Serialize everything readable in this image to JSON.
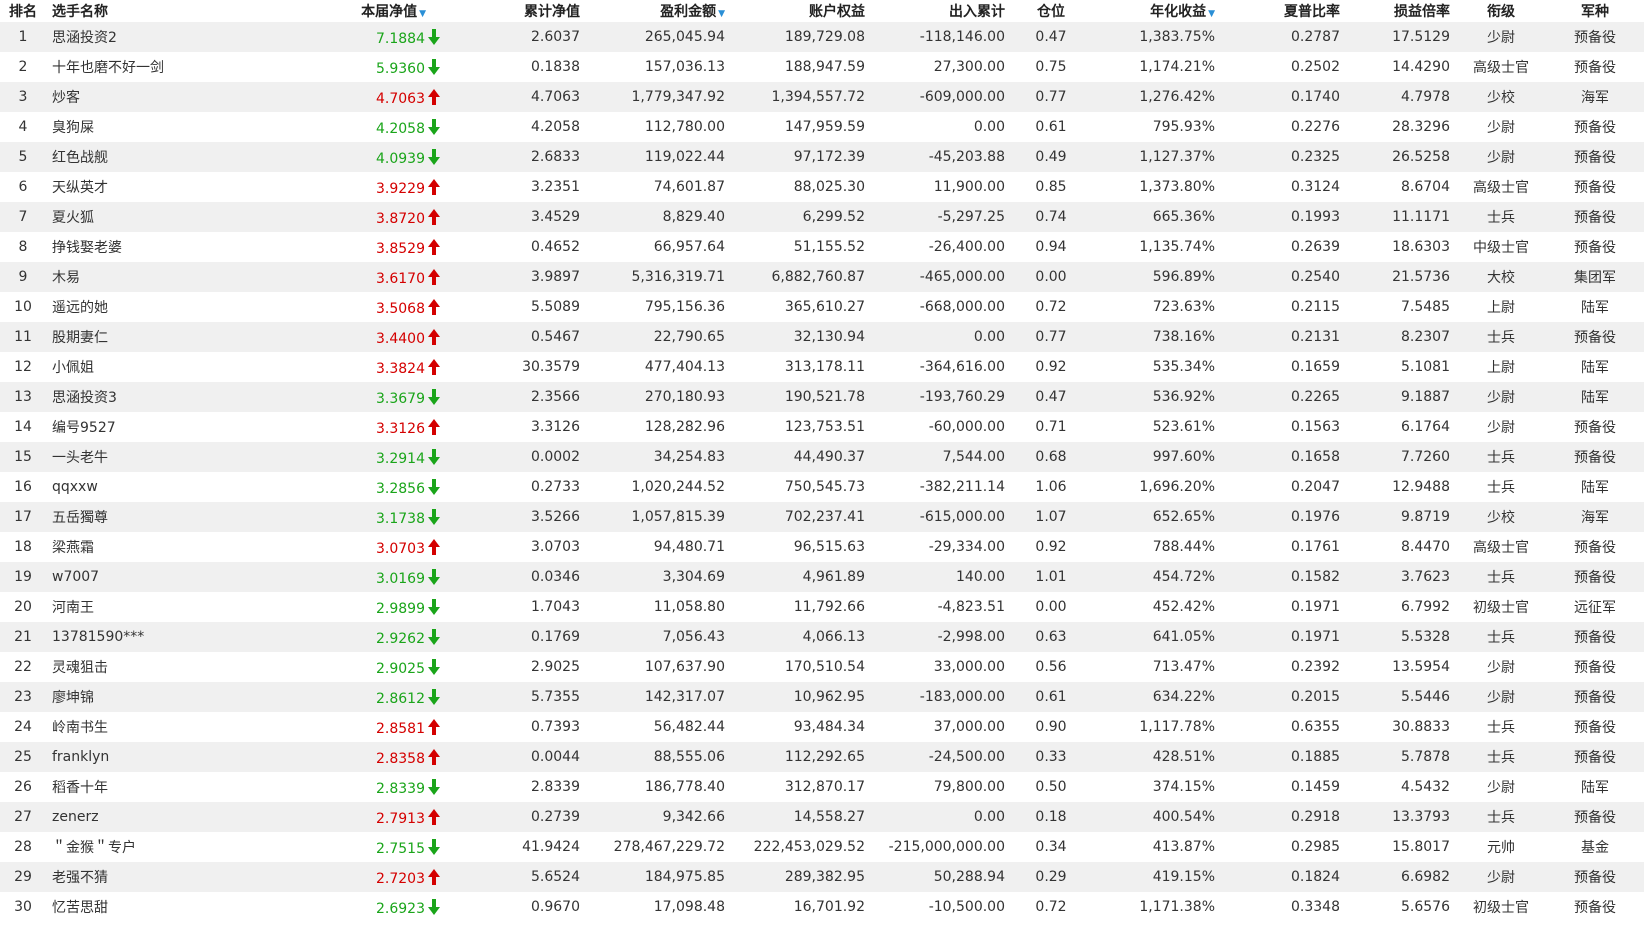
{
  "colors": {
    "up": "#d40000",
    "down": "#1aa51a",
    "sort_indicator": "#2a8fd6",
    "row_stripe": "#f0f0f0"
  },
  "headers": {
    "rank": "排名",
    "name": "选手名称",
    "nav": "本届净值",
    "cum_nav": "累计净值",
    "profit": "盈利金额",
    "equity": "账户权益",
    "flow": "出入累计",
    "position": "仓位",
    "annual": "年化收益",
    "sharpe": "夏普比率",
    "pl_ratio": "损益倍率",
    "title": "衔级",
    "corps": "军种"
  },
  "sort_icon": "sort-desc-icon",
  "rows": [
    {
      "rank": "1",
      "name": "思涵投资2",
      "nav": "7.1884",
      "trend": "down",
      "cum_nav": "2.6037",
      "profit": "265,045.94",
      "equity": "189,729.08",
      "flow": "-118,146.00",
      "position": "0.47",
      "annual": "1,383.75%",
      "sharpe": "0.2787",
      "pl_ratio": "17.5129",
      "title": "少尉",
      "corps": "预备役"
    },
    {
      "rank": "2",
      "name": "十年也磨不好一剑",
      "nav": "5.9360",
      "trend": "down",
      "cum_nav": "0.1838",
      "profit": "157,036.13",
      "equity": "188,947.59",
      "flow": "27,300.00",
      "position": "0.75",
      "annual": "1,174.21%",
      "sharpe": "0.2502",
      "pl_ratio": "14.4290",
      "title": "高级士官",
      "corps": "预备役"
    },
    {
      "rank": "3",
      "name": "炒客",
      "nav": "4.7063",
      "trend": "up",
      "cum_nav": "4.7063",
      "profit": "1,779,347.92",
      "equity": "1,394,557.72",
      "flow": "-609,000.00",
      "position": "0.77",
      "annual": "1,276.42%",
      "sharpe": "0.1740",
      "pl_ratio": "4.7978",
      "title": "少校",
      "corps": "海军"
    },
    {
      "rank": "4",
      "name": "臭狗屎",
      "nav": "4.2058",
      "trend": "down",
      "cum_nav": "4.2058",
      "profit": "112,780.00",
      "equity": "147,959.59",
      "flow": "0.00",
      "position": "0.61",
      "annual": "795.93%",
      "sharpe": "0.2276",
      "pl_ratio": "28.3296",
      "title": "少尉",
      "corps": "预备役"
    },
    {
      "rank": "5",
      "name": "红色战舰",
      "nav": "4.0939",
      "trend": "down",
      "cum_nav": "2.6833",
      "profit": "119,022.44",
      "equity": "97,172.39",
      "flow": "-45,203.88",
      "position": "0.49",
      "annual": "1,127.37%",
      "sharpe": "0.2325",
      "pl_ratio": "26.5258",
      "title": "少尉",
      "corps": "预备役"
    },
    {
      "rank": "6",
      "name": "天纵英才",
      "nav": "3.9229",
      "trend": "up",
      "cum_nav": "3.2351",
      "profit": "74,601.87",
      "equity": "88,025.30",
      "flow": "11,900.00",
      "position": "0.85",
      "annual": "1,373.80%",
      "sharpe": "0.3124",
      "pl_ratio": "8.6704",
      "title": "高级士官",
      "corps": "预备役"
    },
    {
      "rank": "7",
      "name": "夏火狐",
      "nav": "3.8720",
      "trend": "up",
      "cum_nav": "3.4529",
      "profit": "8,829.40",
      "equity": "6,299.52",
      "flow": "-5,297.25",
      "position": "0.74",
      "annual": "665.36%",
      "sharpe": "0.1993",
      "pl_ratio": "11.1171",
      "title": "士兵",
      "corps": "预备役"
    },
    {
      "rank": "8",
      "name": "挣钱娶老婆",
      "nav": "3.8529",
      "trend": "up",
      "cum_nav": "0.4652",
      "profit": "66,957.64",
      "equity": "51,155.52",
      "flow": "-26,400.00",
      "position": "0.94",
      "annual": "1,135.74%",
      "sharpe": "0.2639",
      "pl_ratio": "18.6303",
      "title": "中级士官",
      "corps": "预备役"
    },
    {
      "rank": "9",
      "name": "木易",
      "nav": "3.6170",
      "trend": "up",
      "cum_nav": "3.9897",
      "profit": "5,316,319.71",
      "equity": "6,882,760.87",
      "flow": "-465,000.00",
      "position": "0.00",
      "annual": "596.89%",
      "sharpe": "0.2540",
      "pl_ratio": "21.5736",
      "title": "大校",
      "corps": "集团军"
    },
    {
      "rank": "10",
      "name": "遥远的她",
      "nav": "3.5068",
      "trend": "up",
      "cum_nav": "5.5089",
      "profit": "795,156.36",
      "equity": "365,610.27",
      "flow": "-668,000.00",
      "position": "0.72",
      "annual": "723.63%",
      "sharpe": "0.2115",
      "pl_ratio": "7.5485",
      "title": "上尉",
      "corps": "陆军"
    },
    {
      "rank": "11",
      "name": "股期妻仁",
      "nav": "3.4400",
      "trend": "up",
      "cum_nav": "0.5467",
      "profit": "22,790.65",
      "equity": "32,130.94",
      "flow": "0.00",
      "position": "0.77",
      "annual": "738.16%",
      "sharpe": "0.2131",
      "pl_ratio": "8.2307",
      "title": "士兵",
      "corps": "预备役"
    },
    {
      "rank": "12",
      "name": "小佩姐",
      "nav": "3.3824",
      "trend": "up",
      "cum_nav": "30.3579",
      "profit": "477,404.13",
      "equity": "313,178.11",
      "flow": "-364,616.00",
      "position": "0.92",
      "annual": "535.34%",
      "sharpe": "0.1659",
      "pl_ratio": "5.1081",
      "title": "上尉",
      "corps": "陆军"
    },
    {
      "rank": "13",
      "name": "思涵投资3",
      "nav": "3.3679",
      "trend": "down",
      "cum_nav": "2.3566",
      "profit": "270,180.93",
      "equity": "190,521.78",
      "flow": "-193,760.29",
      "position": "0.47",
      "annual": "536.92%",
      "sharpe": "0.2265",
      "pl_ratio": "9.1887",
      "title": "少尉",
      "corps": "陆军"
    },
    {
      "rank": "14",
      "name": "编号9527",
      "nav": "3.3126",
      "trend": "up",
      "cum_nav": "3.3126",
      "profit": "128,282.96",
      "equity": "123,753.51",
      "flow": "-60,000.00",
      "position": "0.71",
      "annual": "523.61%",
      "sharpe": "0.1563",
      "pl_ratio": "6.1764",
      "title": "少尉",
      "corps": "预备役"
    },
    {
      "rank": "15",
      "name": "一头老牛",
      "nav": "3.2914",
      "trend": "down",
      "cum_nav": "0.0002",
      "profit": "34,254.83",
      "equity": "44,490.37",
      "flow": "7,544.00",
      "position": "0.68",
      "annual": "997.60%",
      "sharpe": "0.1658",
      "pl_ratio": "7.7260",
      "title": "士兵",
      "corps": "预备役"
    },
    {
      "rank": "16",
      "name": "qqxxw",
      "nav": "3.2856",
      "trend": "down",
      "cum_nav": "0.2733",
      "profit": "1,020,244.52",
      "equity": "750,545.73",
      "flow": "-382,211.14",
      "position": "1.06",
      "annual": "1,696.20%",
      "sharpe": "0.2047",
      "pl_ratio": "12.9488",
      "title": "士兵",
      "corps": "陆军"
    },
    {
      "rank": "17",
      "name": "五岳獨尊",
      "nav": "3.1738",
      "trend": "down",
      "cum_nav": "3.5266",
      "profit": "1,057,815.39",
      "equity": "702,237.41",
      "flow": "-615,000.00",
      "position": "1.07",
      "annual": "652.65%",
      "sharpe": "0.1976",
      "pl_ratio": "9.8719",
      "title": "少校",
      "corps": "海军"
    },
    {
      "rank": "18",
      "name": "梁燕霜",
      "nav": "3.0703",
      "trend": "up",
      "cum_nav": "3.0703",
      "profit": "94,480.71",
      "equity": "96,515.63",
      "flow": "-29,334.00",
      "position": "0.92",
      "annual": "788.44%",
      "sharpe": "0.1761",
      "pl_ratio": "8.4470",
      "title": "高级士官",
      "corps": "预备役"
    },
    {
      "rank": "19",
      "name": "w7007",
      "nav": "3.0169",
      "trend": "down",
      "cum_nav": "0.0346",
      "profit": "3,304.69",
      "equity": "4,961.89",
      "flow": "140.00",
      "position": "1.01",
      "annual": "454.72%",
      "sharpe": "0.1582",
      "pl_ratio": "3.7623",
      "title": "士兵",
      "corps": "预备役"
    },
    {
      "rank": "20",
      "name": "河南王",
      "nav": "2.9899",
      "trend": "down",
      "cum_nav": "1.7043",
      "profit": "11,058.80",
      "equity": "11,792.66",
      "flow": "-4,823.51",
      "position": "0.00",
      "annual": "452.42%",
      "sharpe": "0.1971",
      "pl_ratio": "6.7992",
      "title": "初级士官",
      "corps": "远征军"
    },
    {
      "rank": "21",
      "name": "13781590***",
      "nav": "2.9262",
      "trend": "down",
      "cum_nav": "0.1769",
      "profit": "7,056.43",
      "equity": "4,066.13",
      "flow": "-2,998.00",
      "position": "0.63",
      "annual": "641.05%",
      "sharpe": "0.1971",
      "pl_ratio": "5.5328",
      "title": "士兵",
      "corps": "预备役"
    },
    {
      "rank": "22",
      "name": "灵魂狙击",
      "nav": "2.9025",
      "trend": "down",
      "cum_nav": "2.9025",
      "profit": "107,637.90",
      "equity": "170,510.54",
      "flow": "33,000.00",
      "position": "0.56",
      "annual": "713.47%",
      "sharpe": "0.2392",
      "pl_ratio": "13.5954",
      "title": "少尉",
      "corps": "预备役"
    },
    {
      "rank": "23",
      "name": "廖坤锦",
      "nav": "2.8612",
      "trend": "down",
      "cum_nav": "5.7355",
      "profit": "142,317.07",
      "equity": "10,962.95",
      "flow": "-183,000.00",
      "position": "0.61",
      "annual": "634.22%",
      "sharpe": "0.2015",
      "pl_ratio": "5.5446",
      "title": "少尉",
      "corps": "预备役"
    },
    {
      "rank": "24",
      "name": "岭南书生",
      "nav": "2.8581",
      "trend": "up",
      "cum_nav": "0.7393",
      "profit": "56,482.44",
      "equity": "93,484.34",
      "flow": "37,000.00",
      "position": "0.90",
      "annual": "1,117.78%",
      "sharpe": "0.6355",
      "pl_ratio": "30.8833",
      "title": "士兵",
      "corps": "预备役"
    },
    {
      "rank": "25",
      "name": "franklyn",
      "nav": "2.8358",
      "trend": "up",
      "cum_nav": "0.0044",
      "profit": "88,555.06",
      "equity": "112,292.65",
      "flow": "-24,500.00",
      "position": "0.33",
      "annual": "428.51%",
      "sharpe": "0.1885",
      "pl_ratio": "5.7878",
      "title": "士兵",
      "corps": "预备役"
    },
    {
      "rank": "26",
      "name": "稻香十年",
      "nav": "2.8339",
      "trend": "down",
      "cum_nav": "2.8339",
      "profit": "186,778.40",
      "equity": "312,870.17",
      "flow": "79,800.00",
      "position": "0.50",
      "annual": "374.15%",
      "sharpe": "0.1459",
      "pl_ratio": "4.5432",
      "title": "少尉",
      "corps": "陆军"
    },
    {
      "rank": "27",
      "name": "zenerz",
      "nav": "2.7913",
      "trend": "up",
      "cum_nav": "0.2739",
      "profit": "9,342.66",
      "equity": "14,558.27",
      "flow": "0.00",
      "position": "0.18",
      "annual": "400.54%",
      "sharpe": "0.2918",
      "pl_ratio": "13.3793",
      "title": "士兵",
      "corps": "预备役"
    },
    {
      "rank": "28",
      "name": "＂金猴＂专户",
      "nav": "2.7515",
      "trend": "down",
      "cum_nav": "41.9424",
      "profit": "278,467,229.72",
      "equity": "222,453,029.52",
      "flow": "-215,000,000.00",
      "position": "0.34",
      "annual": "413.87%",
      "sharpe": "0.2985",
      "pl_ratio": "15.8017",
      "title": "元帅",
      "corps": "基金"
    },
    {
      "rank": "29",
      "name": "老强不猜",
      "nav": "2.7203",
      "trend": "up",
      "cum_nav": "5.6524",
      "profit": "184,975.85",
      "equity": "289,382.95",
      "flow": "50,288.94",
      "position": "0.29",
      "annual": "419.15%",
      "sharpe": "0.1824",
      "pl_ratio": "6.6982",
      "title": "少尉",
      "corps": "预备役"
    },
    {
      "rank": "30",
      "name": "忆苦思甜",
      "nav": "2.6923",
      "trend": "down",
      "cum_nav": "0.9670",
      "profit": "17,098.48",
      "equity": "16,701.92",
      "flow": "-10,500.00",
      "position": "0.72",
      "annual": "1,171.38%",
      "sharpe": "0.3348",
      "pl_ratio": "5.6576",
      "title": "初级士官",
      "corps": "预备役"
    }
  ]
}
